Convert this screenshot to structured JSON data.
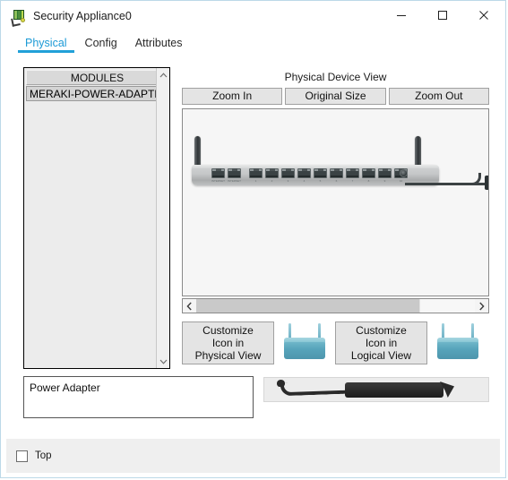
{
  "window": {
    "title": "Security Appliance0",
    "app_icon": "packet-tracer-icon",
    "controls": {
      "minimize": "minimize-icon",
      "maximize": "maximize-icon",
      "close": "close-icon"
    }
  },
  "tabs": [
    {
      "label": "Physical",
      "active": true
    },
    {
      "label": "Config",
      "active": false
    },
    {
      "label": "Attributes",
      "active": false
    }
  ],
  "modules": {
    "header": "MODULES",
    "items": [
      {
        "label": "MERAKI-POWER-ADAPTER"
      }
    ],
    "scroll_up": "chevron-up-icon",
    "scroll_down": "chevron-down-icon"
  },
  "description": {
    "text": "Power Adapter"
  },
  "device_view": {
    "title": "Physical Device View",
    "zoom_buttons": [
      {
        "label": "Zoom In"
      },
      {
        "label": "Original Size"
      },
      {
        "label": "Zoom Out"
      }
    ],
    "scroll_left": "chevron-left-icon",
    "scroll_right": "chevron-right-icon",
    "appliance": {
      "port_labels": [
        "INTERNET",
        "INTERNET",
        "1",
        "2",
        "3",
        "4",
        "5",
        "6",
        "7",
        "8",
        "9",
        "10"
      ]
    }
  },
  "customize": {
    "physical": {
      "line1": "Customize",
      "line2": "Icon in",
      "line3": "Physical View"
    },
    "logical": {
      "line1": "Customize",
      "line2": "Icon in",
      "line3": "Logical View"
    }
  },
  "bottom": {
    "top_checkbox_label": "Top",
    "top_checkbox_checked": false
  },
  "colors": {
    "accent": "#21a0d8",
    "window_border": "#bcd9e8",
    "panel_bg": "#ececec",
    "button_bg": "#e4e4e4",
    "device_icon": "#57a4bb"
  }
}
